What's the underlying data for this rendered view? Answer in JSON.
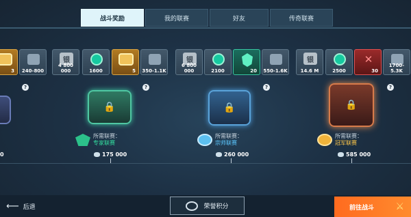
{
  "tabs": [
    {
      "label": "战斗奖励",
      "active": true
    },
    {
      "label": "我的联赛",
      "active": false
    },
    {
      "label": "好友",
      "active": false
    },
    {
      "label": "传奇联赛",
      "active": false
    }
  ],
  "tiers": [
    {
      "rewards": [
        {
          "type": "gold",
          "value": "3"
        },
        {
          "type": "puzzle",
          "value": "240-800"
        }
      ],
      "score": "0",
      "league_required_label": "",
      "league_name": ""
    },
    {
      "rewards": [
        {
          "type": "silver",
          "glyph": "银",
          "value": "4 800 000"
        },
        {
          "type": "green",
          "value": "1600"
        },
        {
          "type": "gold",
          "value": "5"
        },
        {
          "type": "puzzle",
          "value": "350-1.1K"
        }
      ],
      "score": "175 000",
      "league_required_label": "所需联赛：",
      "league_name": "专家联赛"
    },
    {
      "rewards": [
        {
          "type": "silver",
          "glyph": "银",
          "value": "6 800 000"
        },
        {
          "type": "green",
          "value": "2100"
        },
        {
          "type": "teal",
          "value": "20"
        },
        {
          "type": "puzzle",
          "value": "550-1.6K"
        }
      ],
      "score": "260 000",
      "league_required_label": "所需联赛：",
      "league_name": "宗师联赛"
    },
    {
      "rewards": [
        {
          "type": "silver",
          "glyph": "银",
          "value": "14.6 M"
        },
        {
          "type": "green",
          "value": "2500"
        },
        {
          "type": "red",
          "value": "30"
        },
        {
          "type": "puzzle",
          "value": "1700-5.3K"
        }
      ],
      "score": "585 000",
      "league_required_label": "所需联赛：",
      "league_name": "冠军联赛"
    }
  ],
  "help_glyph": "?",
  "bottom": {
    "back_label": "后退",
    "honor_label": "荣誉积分",
    "fight_label": "前往战斗"
  },
  "colors": {
    "accent_orange": "#ff7a26",
    "tab_active": "#dff4fa",
    "league_green": "#34e0a0",
    "league_blue": "#5cc8ff",
    "league_gold": "#ffc84a"
  },
  "icons": {
    "back": "left-arrow-icon",
    "honor": "honor-emblem-icon",
    "fight": "crossed-swords-icon",
    "lock": "lock-icon",
    "score": "trophy-points-icon"
  }
}
